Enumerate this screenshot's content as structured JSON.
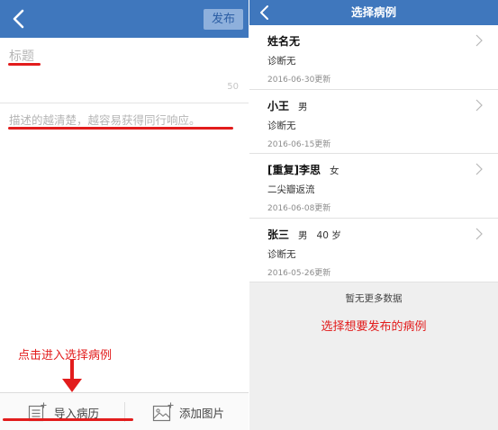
{
  "left": {
    "publish_label": "发布",
    "title_placeholder": "标题",
    "title_counter": "50",
    "description_placeholder": "描述的越清楚，越容易获得同行响应。",
    "hint_text": "点击进入选择病例",
    "toolbar": {
      "import_label": "导入病历",
      "add_image_label": "添加图片"
    }
  },
  "right": {
    "title": "选择病例",
    "cases": [
      {
        "name": "姓名无",
        "gender": "",
        "age": "",
        "diagnosis": "诊断无",
        "updated": "2016-06-30更新"
      },
      {
        "name": "小王",
        "gender": "男",
        "age": "",
        "diagnosis": "诊断无",
        "updated": "2016-06-15更新"
      },
      {
        "name": "[重复]李思",
        "gender": "女",
        "age": "",
        "diagnosis": "二尖瓣返流",
        "updated": "2016-06-08更新"
      },
      {
        "name": "张三",
        "gender": "男",
        "age": "40 岁",
        "diagnosis": "诊断无",
        "updated": "2016-05-26更新"
      }
    ],
    "no_more_text": "暂无更多数据",
    "annotation_text": "选择想要发布的病例"
  },
  "colors": {
    "navbar": "#3f77bd",
    "publish_button": "#8eb0dc",
    "annotation_red": "#e21c1c"
  },
  "icons": {
    "back": "chevron-left-icon",
    "import": "document-add-icon",
    "image": "image-add-icon",
    "row": "chevron-right-icon"
  }
}
